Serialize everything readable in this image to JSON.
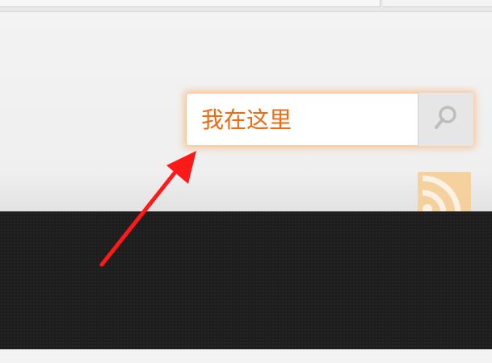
{
  "search": {
    "value": "我在这里",
    "icon": "search-icon"
  },
  "rss": {
    "icon": "rss-icon"
  },
  "annotation": {
    "icon": "red-arrow-icon",
    "color": "#ff1a1a"
  },
  "colors": {
    "accent": "#ef6a10",
    "dark_band": "#1d1d1d",
    "rss_bg": "#f6cf95"
  }
}
